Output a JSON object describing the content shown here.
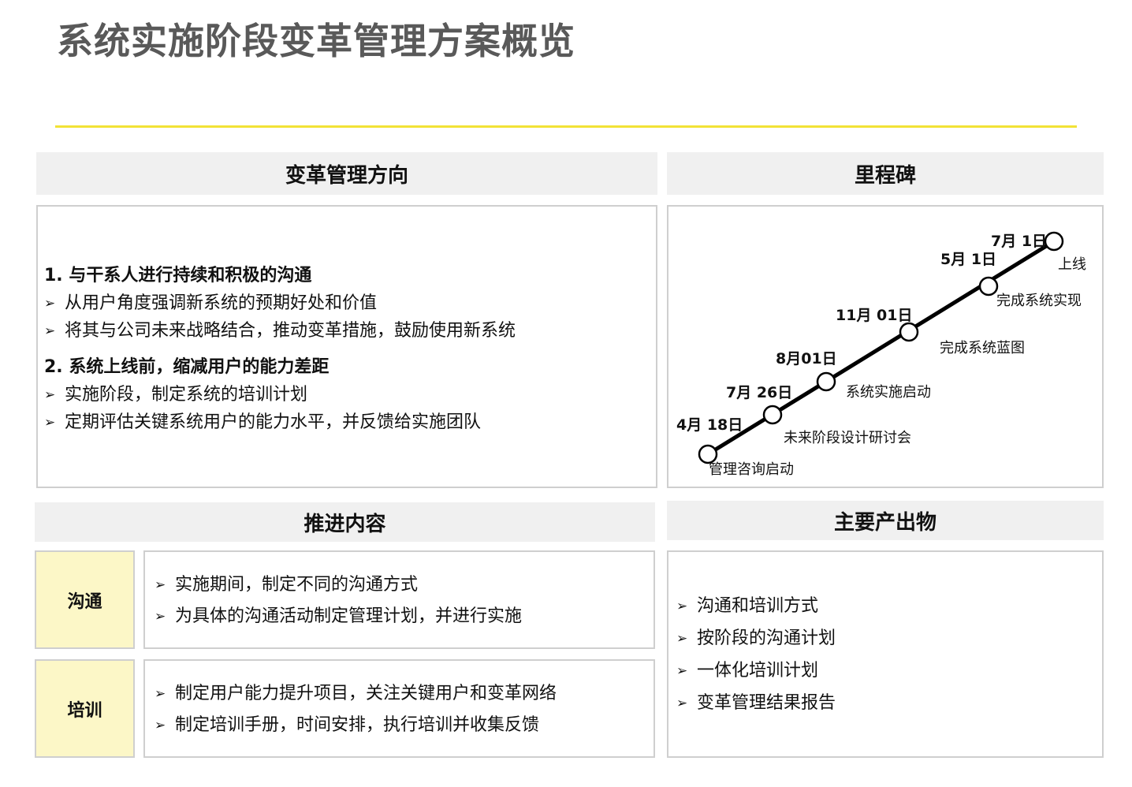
{
  "title": "系统实施阶段变革管理方案概览",
  "colors": {
    "title_rule": "#f2e236",
    "header_bg": "#f0f0f0",
    "tag_bg": "#fcf7c7",
    "border": "#cfcfcf"
  },
  "direction": {
    "header": "变革管理方向",
    "sections": [
      {
        "heading": "1. 与干系人进行持续和积极的沟通",
        "bullets": [
          "从用户角度强调新系统的预期好处和价值",
          "将其与公司未来战略结合，推动变革措施，鼓励使用新系统"
        ]
      },
      {
        "heading": "2. 系统上线前，缩减用户的能力差距",
        "bullets": [
          "实施阶段，制定系统的培训计划",
          "定期评估关键系统用户的能力水平，并反馈给实施团队"
        ]
      }
    ]
  },
  "milestones": {
    "header": "里程碑",
    "items": [
      {
        "date": "4月 18日",
        "label": "管理咨询启动"
      },
      {
        "date": "7月 26日",
        "label": "未来阶段设计研讨会"
      },
      {
        "date": "8月01日",
        "label": "系统实施启动"
      },
      {
        "date": "11月 01日",
        "label": "完成系统蓝图"
      },
      {
        "date": "5月 1日",
        "label": "完成系统实现"
      },
      {
        "date": "7月 1日",
        "label": "上线"
      }
    ]
  },
  "content": {
    "header": "推进内容",
    "rows": [
      {
        "tag": "沟通",
        "bullets": [
          "实施期间，制定不同的沟通方式",
          "为具体的沟通活动制定管理计划，并进行实施"
        ]
      },
      {
        "tag": "培训",
        "bullets": [
          "制定用户能力提升项目，关注关键用户和变革网络",
          "制定培训手册，时间安排，执行培训并收集反馈"
        ]
      }
    ]
  },
  "outputs": {
    "header": "主要产出物",
    "bullets": [
      "沟通和培训方式",
      "按阶段的沟通计划",
      "一体化培训计划",
      "变革管理结果报告"
    ]
  },
  "icons": {
    "bullet": "arrowhead-bullet-icon",
    "milestone": "milestone-circle-icon"
  }
}
